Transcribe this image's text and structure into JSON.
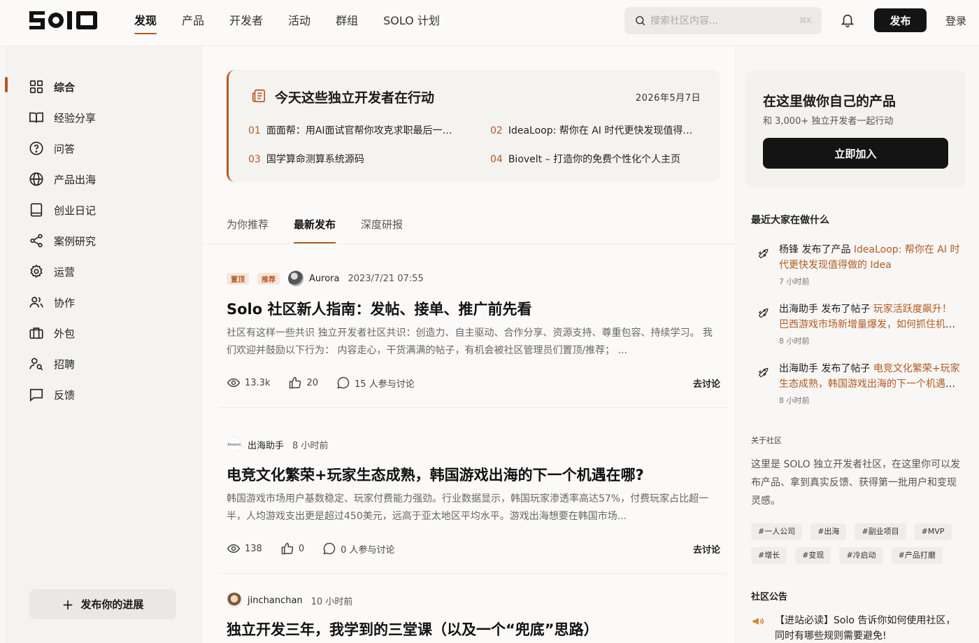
{
  "header": {
    "logo_text": "SOLO",
    "nav": [
      "发现",
      "产品",
      "开发者",
      "活动",
      "群组",
      "SOLO 计划"
    ],
    "search_placeholder": "搜索社区内容...",
    "search_shortcut": "⌘K",
    "publish_label": "发布",
    "login_label": "登录"
  },
  "sidebar": {
    "items": [
      {
        "label": "综合",
        "icon": "grid-icon"
      },
      {
        "label": "经验分享",
        "icon": "book-icon"
      },
      {
        "label": "问答",
        "icon": "question-icon"
      },
      {
        "label": "产品出海",
        "icon": "globe-icon"
      },
      {
        "label": "创业日记",
        "icon": "notebook-icon"
      },
      {
        "label": "案例研究",
        "icon": "share-icon"
      },
      {
        "label": "运营",
        "icon": "gear-icon"
      },
      {
        "label": "协作",
        "icon": "users-icon"
      },
      {
        "label": "外包",
        "icon": "briefcase-icon"
      },
      {
        "label": "招聘",
        "icon": "user-search-icon"
      },
      {
        "label": "反馈",
        "icon": "message-icon"
      }
    ],
    "progress_button": "发布你的进展"
  },
  "highlights": {
    "title": "今天这些独立开发者在行动",
    "date": "2026年5月7日",
    "items": [
      {
        "num": "01",
        "text": "面面帮：用AI面试官帮你攻克求职最后一公里"
      },
      {
        "num": "02",
        "text": "IdeaLoop: 帮你在 AI 时代更快发现值得做的 Idea"
      },
      {
        "num": "03",
        "text": "国学算命测算系统源码"
      },
      {
        "num": "04",
        "text": "Biovelt – 打造你的免费个性化个人主页"
      }
    ]
  },
  "tabs": [
    "为你推荐",
    "最新发布",
    "深度研报"
  ],
  "posts": [
    {
      "badges": [
        "置顶",
        "推荐"
      ],
      "author": "Aurora",
      "time": "2023/7/21 07:55",
      "title": "Solo 社区新人指南：发帖、接单、推广前先看",
      "excerpt": "社区有这样一些共识 独立开发者社区共识：创造力、自主驱动、合作分享、资源支持、尊重包容、持续学习。 我们欢迎并鼓励以下行为： 内容走心，干货满满的帖子，有机会被社区管理员们置顶/推荐； ...",
      "views": "13.3k",
      "likes": "20",
      "comments": "15 人参与讨论",
      "discuss": "去讨论"
    },
    {
      "badges": [],
      "author": "出海助手",
      "time": "8 小时前",
      "title": "电竞文化繁荣+玩家生态成熟，韩国游戏出海的下一个机遇在哪?",
      "excerpt": "韩国游戏市场用户基数稳定、玩家付费能力强劲。行业数据显示，韩国玩家渗透率高达57%，付费玩家占比超一半，人均游戏支出更是超过450美元，远高于亚太地区平均水平。游戏出海想要在韩国市场...",
      "views": "138",
      "likes": "0",
      "comments": "0 人参与讨论",
      "discuss": "去讨论"
    },
    {
      "badges": [],
      "author": "jinchanchan",
      "time": "10 小时前",
      "title": "独立开发三年，我学到的三堂课（以及一个“兜底”思路）"
    }
  ],
  "right": {
    "cta_title": "在这里做你自己的产品",
    "cta_sub": "和 3,000+ 独立开发者一起行动",
    "cta_button": "立即加入",
    "activity_title": "最近大家在做什么",
    "activities": [
      {
        "prefix": "杨锋 发布了产品 ",
        "link": "IdeaLoop: 帮你在 AI 时代更快发现值得做的 Idea",
        "time": "7 小时前"
      },
      {
        "prefix": "出海助手 发布了帖子 ",
        "link": "玩家活跃度飙升！巴西游戏市场新增量爆发，如何抓住机遇？",
        "time": "8 小时前"
      },
      {
        "prefix": "出海助手 发布了帖子 ",
        "link": "电竞文化繁荣+玩家生态成熟，韩国游戏出海的下一个机遇在哪?",
        "time": "8 小时前"
      }
    ],
    "about_title": "关于社区",
    "about_text": "这里是 SOLO 独立开发者社区，在这里你可以发布产品、拿到真实反馈、获得第一批用户和变现灵感。",
    "tags": [
      "#一人公司",
      "#出海",
      "#副业项目",
      "#MVP",
      "#增长",
      "#变现",
      "#冷启动",
      "#产品打磨"
    ],
    "notice_title": "社区公告",
    "notice_text": "【进站必读】Solo 告诉你如何使用社区，同时有哪些规则需要避免!"
  },
  "colors": {
    "accent": "#b45a22",
    "dark": "#141414"
  }
}
